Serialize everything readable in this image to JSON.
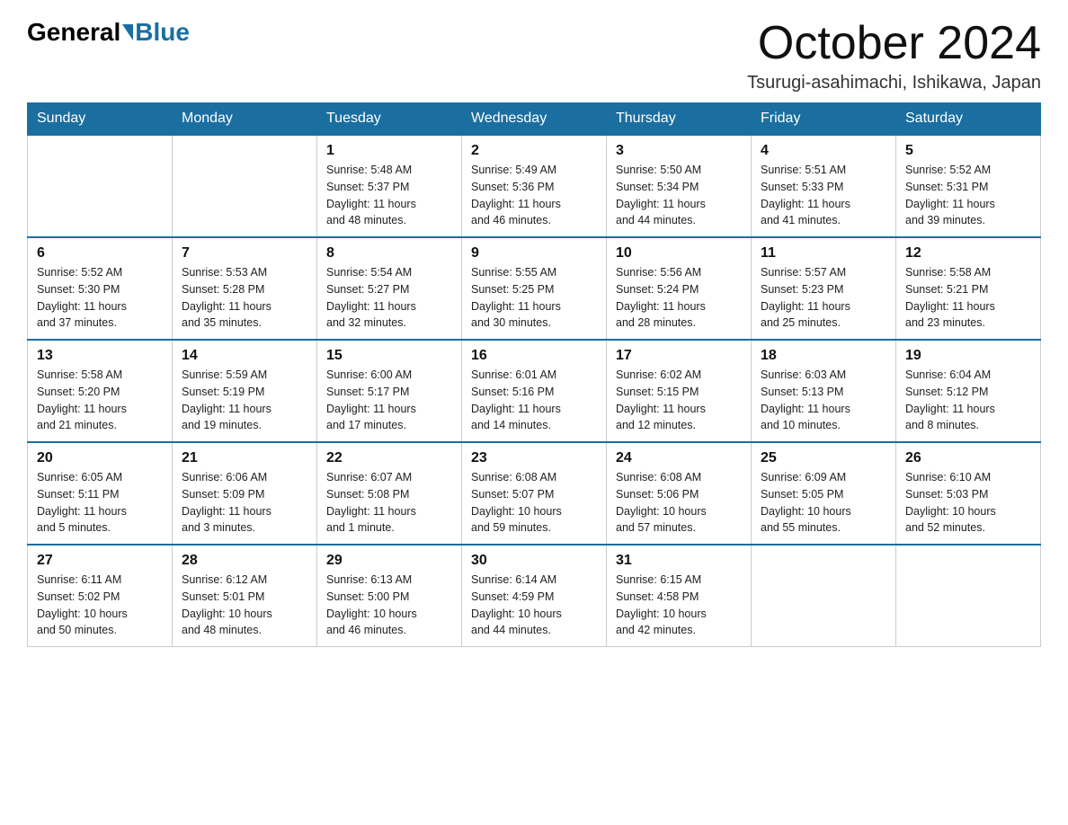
{
  "header": {
    "logo_general": "General",
    "logo_blue": "Blue",
    "month": "October 2024",
    "location": "Tsurugi-asahimachi, Ishikawa, Japan"
  },
  "weekdays": [
    "Sunday",
    "Monday",
    "Tuesday",
    "Wednesday",
    "Thursday",
    "Friday",
    "Saturday"
  ],
  "weeks": [
    [
      {
        "day": "",
        "info": ""
      },
      {
        "day": "",
        "info": ""
      },
      {
        "day": "1",
        "info": "Sunrise: 5:48 AM\nSunset: 5:37 PM\nDaylight: 11 hours\nand 48 minutes."
      },
      {
        "day": "2",
        "info": "Sunrise: 5:49 AM\nSunset: 5:36 PM\nDaylight: 11 hours\nand 46 minutes."
      },
      {
        "day": "3",
        "info": "Sunrise: 5:50 AM\nSunset: 5:34 PM\nDaylight: 11 hours\nand 44 minutes."
      },
      {
        "day": "4",
        "info": "Sunrise: 5:51 AM\nSunset: 5:33 PM\nDaylight: 11 hours\nand 41 minutes."
      },
      {
        "day": "5",
        "info": "Sunrise: 5:52 AM\nSunset: 5:31 PM\nDaylight: 11 hours\nand 39 minutes."
      }
    ],
    [
      {
        "day": "6",
        "info": "Sunrise: 5:52 AM\nSunset: 5:30 PM\nDaylight: 11 hours\nand 37 minutes."
      },
      {
        "day": "7",
        "info": "Sunrise: 5:53 AM\nSunset: 5:28 PM\nDaylight: 11 hours\nand 35 minutes."
      },
      {
        "day": "8",
        "info": "Sunrise: 5:54 AM\nSunset: 5:27 PM\nDaylight: 11 hours\nand 32 minutes."
      },
      {
        "day": "9",
        "info": "Sunrise: 5:55 AM\nSunset: 5:25 PM\nDaylight: 11 hours\nand 30 minutes."
      },
      {
        "day": "10",
        "info": "Sunrise: 5:56 AM\nSunset: 5:24 PM\nDaylight: 11 hours\nand 28 minutes."
      },
      {
        "day": "11",
        "info": "Sunrise: 5:57 AM\nSunset: 5:23 PM\nDaylight: 11 hours\nand 25 minutes."
      },
      {
        "day": "12",
        "info": "Sunrise: 5:58 AM\nSunset: 5:21 PM\nDaylight: 11 hours\nand 23 minutes."
      }
    ],
    [
      {
        "day": "13",
        "info": "Sunrise: 5:58 AM\nSunset: 5:20 PM\nDaylight: 11 hours\nand 21 minutes."
      },
      {
        "day": "14",
        "info": "Sunrise: 5:59 AM\nSunset: 5:19 PM\nDaylight: 11 hours\nand 19 minutes."
      },
      {
        "day": "15",
        "info": "Sunrise: 6:00 AM\nSunset: 5:17 PM\nDaylight: 11 hours\nand 17 minutes."
      },
      {
        "day": "16",
        "info": "Sunrise: 6:01 AM\nSunset: 5:16 PM\nDaylight: 11 hours\nand 14 minutes."
      },
      {
        "day": "17",
        "info": "Sunrise: 6:02 AM\nSunset: 5:15 PM\nDaylight: 11 hours\nand 12 minutes."
      },
      {
        "day": "18",
        "info": "Sunrise: 6:03 AM\nSunset: 5:13 PM\nDaylight: 11 hours\nand 10 minutes."
      },
      {
        "day": "19",
        "info": "Sunrise: 6:04 AM\nSunset: 5:12 PM\nDaylight: 11 hours\nand 8 minutes."
      }
    ],
    [
      {
        "day": "20",
        "info": "Sunrise: 6:05 AM\nSunset: 5:11 PM\nDaylight: 11 hours\nand 5 minutes."
      },
      {
        "day": "21",
        "info": "Sunrise: 6:06 AM\nSunset: 5:09 PM\nDaylight: 11 hours\nand 3 minutes."
      },
      {
        "day": "22",
        "info": "Sunrise: 6:07 AM\nSunset: 5:08 PM\nDaylight: 11 hours\nand 1 minute."
      },
      {
        "day": "23",
        "info": "Sunrise: 6:08 AM\nSunset: 5:07 PM\nDaylight: 10 hours\nand 59 minutes."
      },
      {
        "day": "24",
        "info": "Sunrise: 6:08 AM\nSunset: 5:06 PM\nDaylight: 10 hours\nand 57 minutes."
      },
      {
        "day": "25",
        "info": "Sunrise: 6:09 AM\nSunset: 5:05 PM\nDaylight: 10 hours\nand 55 minutes."
      },
      {
        "day": "26",
        "info": "Sunrise: 6:10 AM\nSunset: 5:03 PM\nDaylight: 10 hours\nand 52 minutes."
      }
    ],
    [
      {
        "day": "27",
        "info": "Sunrise: 6:11 AM\nSunset: 5:02 PM\nDaylight: 10 hours\nand 50 minutes."
      },
      {
        "day": "28",
        "info": "Sunrise: 6:12 AM\nSunset: 5:01 PM\nDaylight: 10 hours\nand 48 minutes."
      },
      {
        "day": "29",
        "info": "Sunrise: 6:13 AM\nSunset: 5:00 PM\nDaylight: 10 hours\nand 46 minutes."
      },
      {
        "day": "30",
        "info": "Sunrise: 6:14 AM\nSunset: 4:59 PM\nDaylight: 10 hours\nand 44 minutes."
      },
      {
        "day": "31",
        "info": "Sunrise: 6:15 AM\nSunset: 4:58 PM\nDaylight: 10 hours\nand 42 minutes."
      },
      {
        "day": "",
        "info": ""
      },
      {
        "day": "",
        "info": ""
      }
    ]
  ]
}
